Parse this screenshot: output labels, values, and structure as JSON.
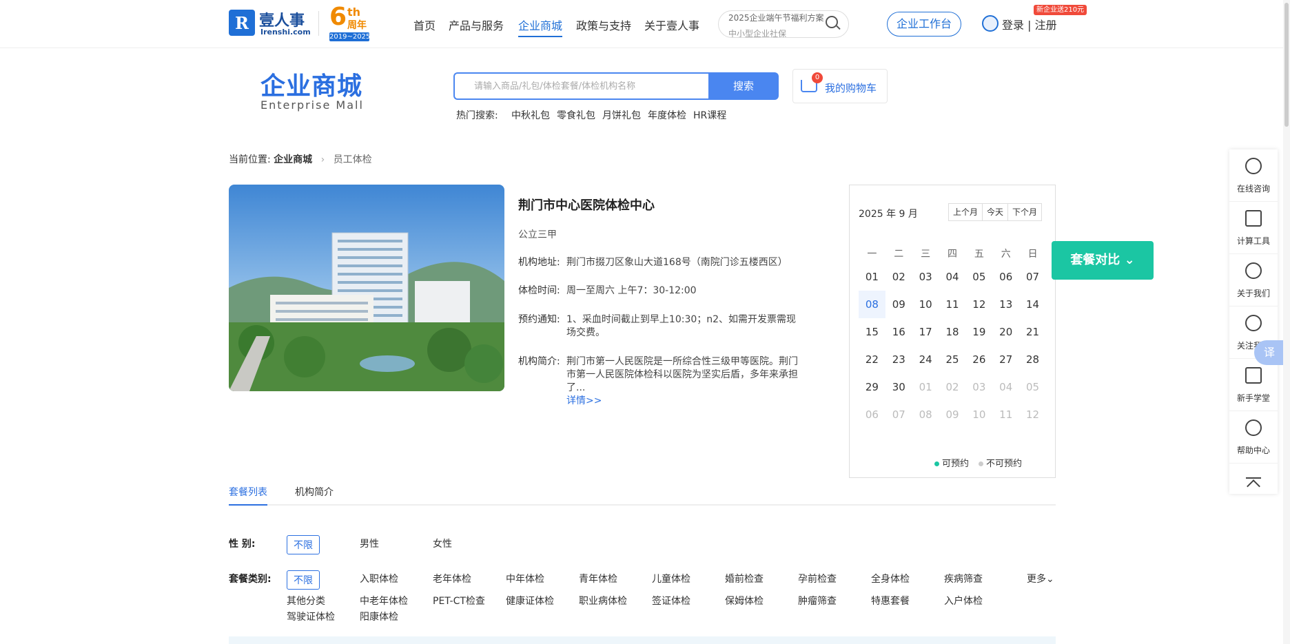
{
  "header": {
    "logo_mark": "R",
    "logo_cn": "壹人事",
    "logo_en": "Irenshi.com",
    "anniv_num": "6",
    "anniv_th": "th",
    "anniv_zn": "周年",
    "anniv_years": "2019~2025",
    "nav": [
      {
        "label": "首页"
      },
      {
        "label": "产品与服务"
      },
      {
        "label": "企业商城"
      },
      {
        "label": "政策与支持"
      },
      {
        "label": "关于壹人事"
      }
    ],
    "search_line1": "2025企业端午节福利方案",
    "search_line2": "中小型企业社保",
    "workbench": "企业工作台",
    "login": "登录 | 注册",
    "promo_badge": "新企业送210元"
  },
  "mall": {
    "title_cn": "企业商城",
    "title_en": "Enterprise  Mall",
    "search_placeholder": "请输入商品/礼包/体检套餐/体检机构名称",
    "search_button": "搜索",
    "cart_count": "0",
    "cart_label": "我的购物车",
    "hot_label": "热门搜索:",
    "hot_items": [
      "中秋礼包",
      "零食礼包",
      "月饼礼包",
      "年度体检",
      "HR课程"
    ]
  },
  "breadcrumb": {
    "prefix": "当前位置:",
    "level1": "企业商城",
    "level2": "员工体检"
  },
  "hospital": {
    "name": "荆门市中心医院体检中心",
    "grade": "公立三甲",
    "address_label": "机构地址:",
    "address": "荆门市掇刀区象山大道168号（南院门诊五楼西区）",
    "hours_label": "体检时间:",
    "hours": "周一至周六 上午7：30-12:00",
    "notice_label": "预约通知:",
    "notice": "1、采血时间截止到早上10:30；n2、如需开发票需现场交费。",
    "intro_label": "机构简介:",
    "intro": "荆门市第一人民医院是一所综合性三级甲等医院。荆门市第一人民医院体检科以医院为坚实后盾，多年来承担了...",
    "more": "详情>>"
  },
  "calendar": {
    "month": "2025 年 9 月",
    "btn_prev": "上个月",
    "btn_today": "今天",
    "btn_next": "下个月",
    "weekdays": [
      "一",
      "二",
      "三",
      "四",
      "五",
      "六",
      "日"
    ],
    "days": [
      "01",
      "02",
      "03",
      "04",
      "05",
      "06",
      "07",
      "08",
      "09",
      "10",
      "11",
      "12",
      "13",
      "14",
      "15",
      "16",
      "17",
      "18",
      "19",
      "20",
      "21",
      "22",
      "23",
      "24",
      "25",
      "26",
      "27",
      "28",
      "29",
      "30",
      "01",
      "02",
      "03",
      "04",
      "05",
      "06",
      "07",
      "08",
      "09",
      "10",
      "11",
      "12"
    ],
    "today_index": 7,
    "dim_from_index": 30,
    "legend_available": "可预约",
    "legend_unavailable": "不可预约",
    "available_color": "#1bc6a3",
    "unavailable_color": "#cccccc"
  },
  "compare_button": "套餐对比",
  "sidebar": [
    {
      "label": "在线咨询",
      "icon": "headset-icon"
    },
    {
      "label": "计算工具",
      "icon": "calculator-icon"
    },
    {
      "label": "关于我们",
      "icon": "person-icon"
    },
    {
      "label": "关注我们",
      "icon": "person-add-icon"
    },
    {
      "label": "新手学堂",
      "icon": "book-icon"
    },
    {
      "label": "帮助中心",
      "icon": "help-icon"
    }
  ],
  "translate_badge": "译",
  "tabs": [
    {
      "label": "套餐列表"
    },
    {
      "label": "机构简介"
    }
  ],
  "filters": {
    "gender_label": "性    别:",
    "gender_options": [
      "不限",
      "男性",
      "女性"
    ],
    "type_label": "套餐类别:",
    "type_options_row1": [
      "不限",
      "入职体检",
      "老年体检",
      "中年体检",
      "青年体检",
      "儿童体检",
      "婚前检查",
      "孕前检查",
      "全身体检",
      "疾病筛查"
    ],
    "type_options_row2": [
      "其他分类",
      "中老年体检",
      "PET-CT检查",
      "健康证体检",
      "职业病体检",
      "签证体检",
      "保姆体检",
      "肿瘤筛查",
      "特惠套餐",
      "入户体检"
    ],
    "type_options_row3": [
      "驾驶证体检",
      "阳康体检"
    ],
    "more": "更多"
  },
  "colors": {
    "brand": "#1f6fd6",
    "accent": "#4a86f0",
    "compare": "#1bc6a3",
    "badge": "#f04a3a"
  }
}
